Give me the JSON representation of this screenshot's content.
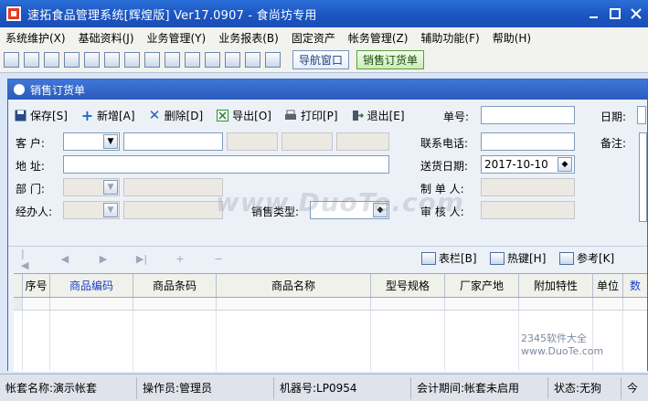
{
  "window": {
    "title": "速拓食品管理系统[辉煌版] Ver17.0907  -  食尚坊专用",
    "controls": [
      "minimize-icon",
      "maximize-icon",
      "close-icon"
    ]
  },
  "menubar": {
    "items": [
      "系统维护(X)",
      "基础资料(J)",
      "业务管理(Y)",
      "业务报表(B)",
      "固定资产",
      "帐务管理(Z)",
      "辅助功能(F)",
      "帮助(H)"
    ]
  },
  "toolbar": {
    "nav_window_label": "导航窗口",
    "sales_order_label": "销售订货单"
  },
  "sales_order": {
    "title": "销售订货单",
    "actions": {
      "save": "保存[S]",
      "new": "新增[A]",
      "delete": "删除[D]",
      "export": "导出[O]",
      "print": "打印[P]",
      "exit": "退出[E]"
    },
    "fields": {
      "order_no_label": "单号:",
      "date_label": "日期:",
      "customer_label": "客  户:",
      "phone_label": "联系电话:",
      "note_label": "备注:",
      "address_label": "地  址:",
      "delivery_date_label": "送货日期:",
      "delivery_date_value": "2017-10-10",
      "department_label": "部  门:",
      "maker_label": "制 单 人:",
      "handler_label": "经办人:",
      "sales_type_label": "销售类型:",
      "auditor_label": "审 核 人:"
    },
    "grid_actions": {
      "columns": "表栏[B]",
      "hotkeys": "热键[H]",
      "reference": "参考[K]"
    },
    "columns": [
      "序号",
      "商品编码",
      "商品条码",
      "商品名称",
      "型号规格",
      "厂家产地",
      "附加特性",
      "单位",
      "数"
    ]
  },
  "statusbar": {
    "account": "帐套名称:演示帐套",
    "operator": "操作员:管理员",
    "machine": "机器号:LP0954",
    "period": "会计期间:帐套未启用",
    "state": "状态:无狗",
    "extra": "今"
  },
  "watermark": {
    "text": "www.DuoTe.com",
    "logo": "2345软件大全 www.DuoTe.com"
  },
  "colors": {
    "title_bar": "#1b55c2",
    "column_header_blue": "#1a3fc4"
  }
}
